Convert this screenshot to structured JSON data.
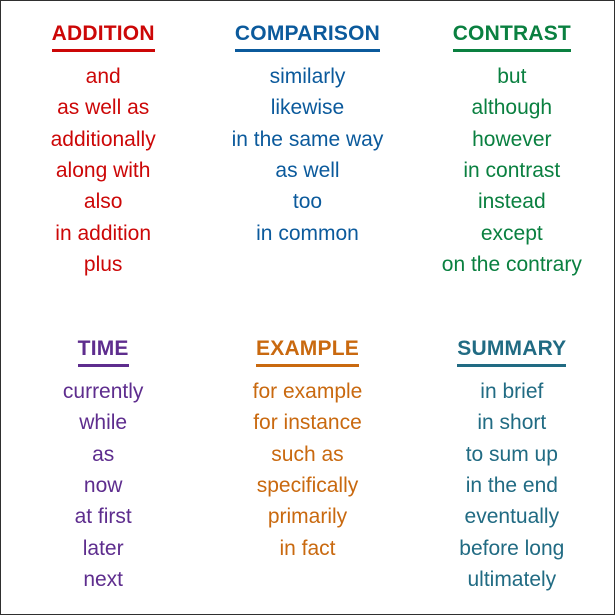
{
  "poster": {
    "background_color": "#ffffff",
    "border_color": "#2f2f2f"
  },
  "columns": [
    {
      "key": "addition",
      "heading": "ADDITION",
      "color": "#cc0707",
      "words": [
        "and",
        "as well as",
        "additionally",
        "along with",
        "also",
        "in addition",
        "plus"
      ]
    },
    {
      "key": "comparison",
      "heading": "COMPARISON",
      "color": "#0b5a9c",
      "words": [
        "similarly",
        "likewise",
        "in the same way",
        "as well",
        "too",
        "in common"
      ]
    },
    {
      "key": "contrast",
      "heading": "CONTRAST",
      "color": "#0a8040",
      "words": [
        "but",
        "although",
        "however",
        "in contrast",
        "instead",
        "except",
        "on the contrary"
      ]
    },
    {
      "key": "time",
      "heading": "TIME",
      "color": "#5e2d8e",
      "words": [
        "currently",
        "while",
        "as",
        "now",
        "at first",
        "later",
        "next"
      ]
    },
    {
      "key": "example",
      "heading": "EXAMPLE",
      "color": "#c9690f",
      "words": [
        "for example",
        "for instance",
        "such as",
        "specifically",
        "primarily",
        "in fact"
      ]
    },
    {
      "key": "summary",
      "heading": "SUMMARY",
      "color": "#216b83",
      "words": [
        "in brief",
        "in short",
        "to sum up",
        "in the end",
        "eventually",
        "before long",
        "ultimately"
      ]
    }
  ]
}
